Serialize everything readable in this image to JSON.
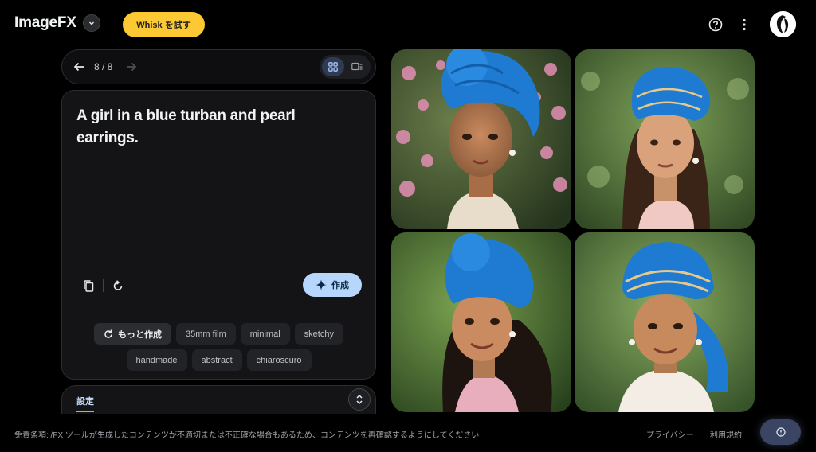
{
  "header": {
    "app_title": "ImageFX",
    "whisk_button": "Whisk を試す"
  },
  "nav": {
    "counter": "8 / 8"
  },
  "prompt": {
    "text": "A girl in a blue turban and pearl earrings.",
    "create_label": "作成"
  },
  "chips": {
    "more_label": "もっと作成",
    "row1": [
      "35mm film",
      "minimal",
      "sketchy"
    ],
    "row2": [
      "handmade",
      "abstract",
      "chiaroscuro"
    ]
  },
  "settings": {
    "tab_label": "設定"
  },
  "images": [
    {
      "name": "generated-image-1",
      "background": "pink-flowers"
    },
    {
      "name": "generated-image-2",
      "background": "green-foliage"
    },
    {
      "name": "generated-image-3",
      "background": "green-foliage"
    },
    {
      "name": "generated-image-4",
      "background": "green-foliage"
    }
  ],
  "footer": {
    "disclaimer": "免責条項: /FX ツールが生成したコンテンツが不適切または不正確な場合もあるため、コンテンツを再確認するようにしてください",
    "privacy": "プライバシー",
    "terms": "利用規約"
  },
  "colors": {
    "accent_yellow": "#fcc934",
    "create_button": "#b7d6fb",
    "turban_blue": "#1f7bd1",
    "background": "#000000"
  },
  "icons": [
    "dropdown-icon",
    "help-icon",
    "more-vert-icon",
    "arrow-back-icon",
    "arrow-forward-icon",
    "grid-view-icon",
    "list-view-icon",
    "copy-icon",
    "reset-icon",
    "sparkle-icon",
    "refresh-icon",
    "expand-icon",
    "feedback-icon"
  ]
}
